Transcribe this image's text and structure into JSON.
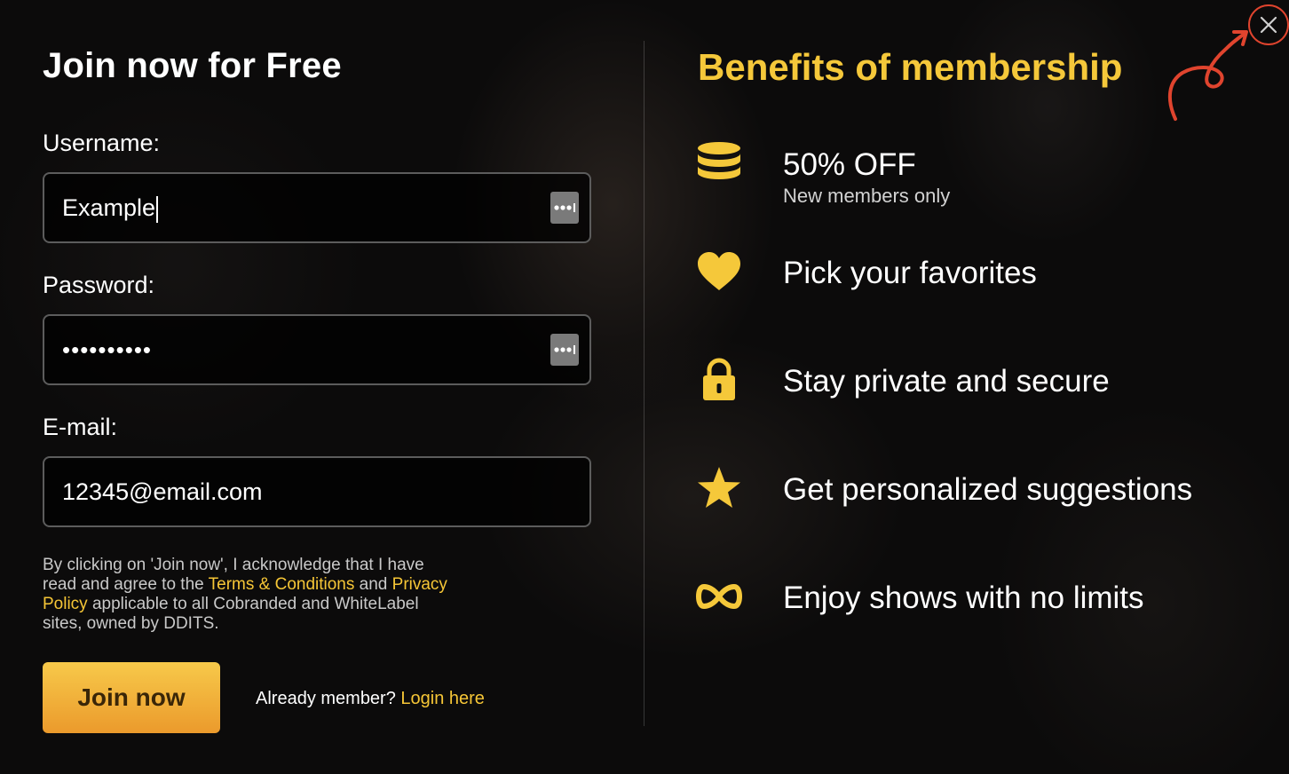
{
  "form": {
    "title": "Join now for Free",
    "username": {
      "label": "Username:",
      "value": "Example"
    },
    "password": {
      "label": "Password:",
      "value": "••••••••••"
    },
    "email": {
      "label": "E-mail:",
      "value": "12345@email.com"
    },
    "consent": {
      "text_1": "By clicking on 'Join now', I acknowledge that I have read and agree to the ",
      "terms_link": "Terms & Conditions",
      "text_2": " and ",
      "privacy_link": "Privacy Policy",
      "text_3": " applicable to all Cobranded and WhiteLabel sites, owned by DDITS."
    },
    "join_button": "Join now",
    "already_member": "Already member?",
    "login_link": "Login here"
  },
  "benefits": {
    "title": "Benefits of membership",
    "items": [
      {
        "icon": "coins-stack-icon",
        "text": "50% OFF",
        "sub": "New members only"
      },
      {
        "icon": "heart-icon",
        "text": "Pick your favorites"
      },
      {
        "icon": "lock-icon",
        "text": "Stay private and secure"
      },
      {
        "icon": "star-icon",
        "text": "Get personalized suggestions"
      },
      {
        "icon": "infinity-icon",
        "text": "Enjoy shows with no limits"
      }
    ]
  },
  "colors": {
    "accent": "#f5c83a",
    "button_top": "#f7c94a",
    "button_bottom": "#eb9a2c",
    "annotation": "#e0442e"
  }
}
